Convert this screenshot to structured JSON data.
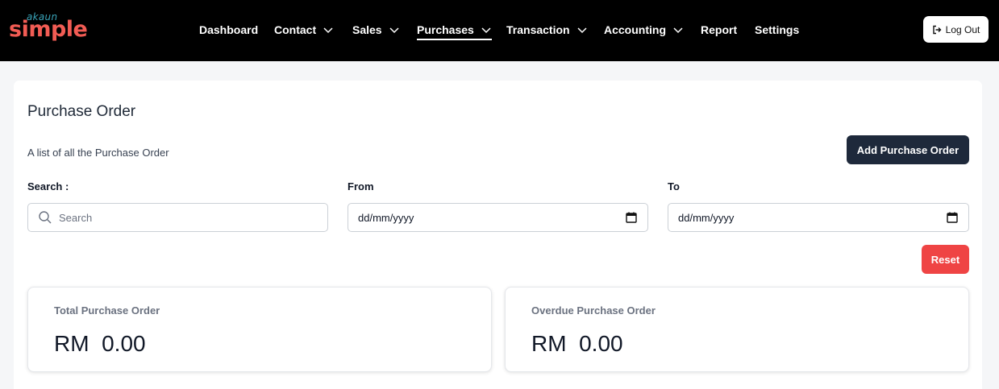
{
  "brand": {
    "small": "akaun",
    "big": "simple"
  },
  "nav": {
    "items": [
      {
        "label": "Dashboard",
        "dropdown": false
      },
      {
        "label": "Contact",
        "dropdown": true
      },
      {
        "label": "Sales",
        "dropdown": true
      },
      {
        "label": "Purchases",
        "dropdown": true,
        "active": true
      },
      {
        "label": "Transaction",
        "dropdown": true
      },
      {
        "label": "Accounting",
        "dropdown": true
      },
      {
        "label": "Report",
        "dropdown": false
      },
      {
        "label": "Settings",
        "dropdown": false
      }
    ],
    "logout_label": "Log Out"
  },
  "page": {
    "title": "Purchase Order",
    "subtitle": "A list of all the Purchase Order",
    "add_label": "Add Purchase Order"
  },
  "filters": {
    "search_label": "Search :",
    "search_placeholder": "Search",
    "from_label": "From",
    "from_value": "dd/mm/yyyy",
    "to_label": "To",
    "to_value": "dd/mm/yyyy",
    "reset_label": "Reset"
  },
  "stats": [
    {
      "label": "Total Purchase Order",
      "value": "RM  0.00"
    },
    {
      "label": "Overdue Purchase Order",
      "value": "RM  0.00"
    }
  ],
  "colors": {
    "navbar": "#000000",
    "primary_button": "#1e293b",
    "reset_button": "#ef4444",
    "brand_red": "#f25c54",
    "brand_teal": "#39a3b8"
  }
}
